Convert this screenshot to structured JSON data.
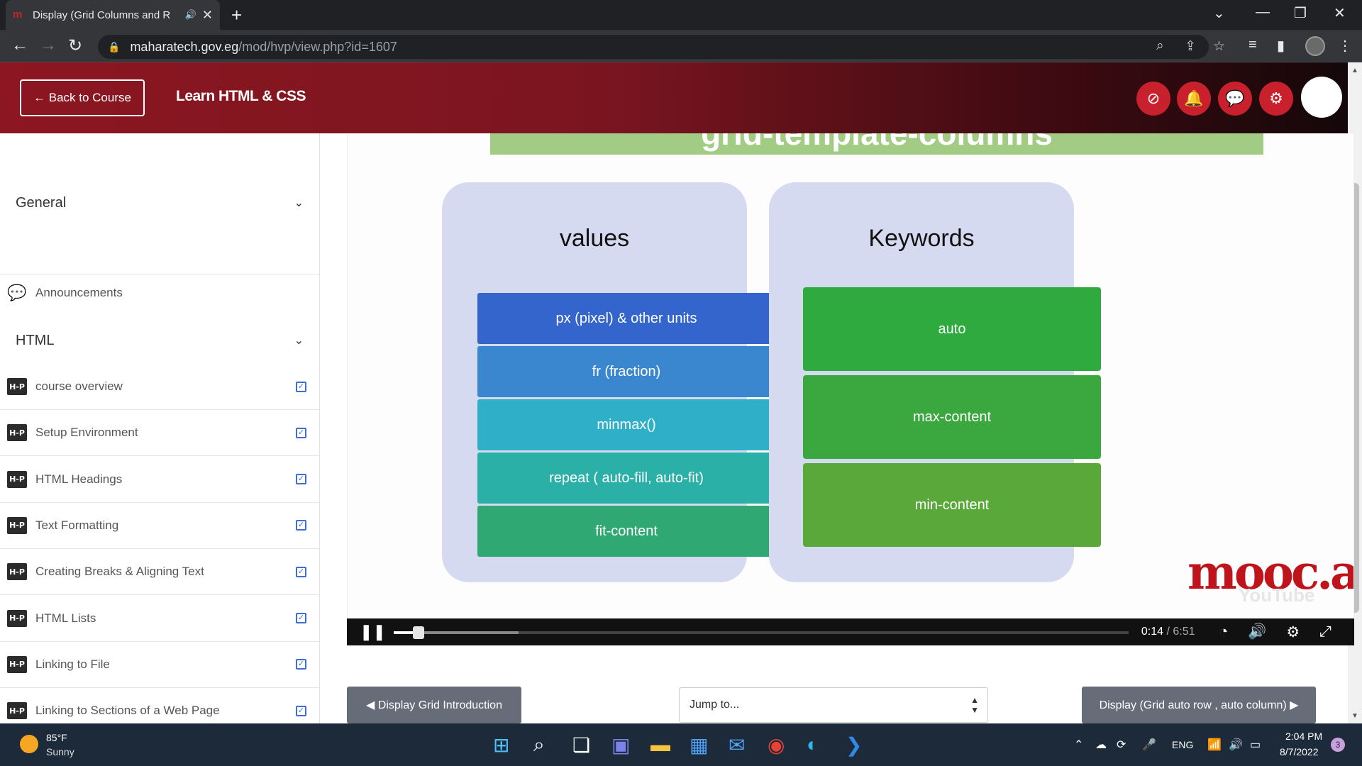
{
  "browser": {
    "tab_title": "Display (Grid Columns and R",
    "url_host": "maharatech.gov.eg",
    "url_path": "/mod/hvp/view.php?id=1607"
  },
  "header": {
    "back_label": "← Back to Course",
    "course_title": "Learn HTML & CSS"
  },
  "sidebar": {
    "sections": [
      {
        "label": "General"
      },
      {
        "label": "HTML"
      }
    ],
    "announcements": "Announcements",
    "items": [
      {
        "label": "course overview"
      },
      {
        "label": "Setup Environment"
      },
      {
        "label": "HTML Headings"
      },
      {
        "label": "Text Formatting"
      },
      {
        "label": "Creating Breaks & Aligning Text"
      },
      {
        "label": "HTML Lists"
      },
      {
        "label": "Linking to File"
      },
      {
        "label": "Linking to Sections of a Web Page"
      }
    ],
    "icon_text": "H-P"
  },
  "video": {
    "slide_title": "grid-template-columns",
    "values_title": "values",
    "keywords_title": "Keywords",
    "values": [
      "px (pixel) & other units",
      "fr (fraction)",
      "minmax()",
      "repeat ( auto-fill, auto-fit)",
      "fit-content"
    ],
    "keywords": [
      "auto",
      "max-content",
      "min-content"
    ],
    "logo_text": "mooc.a",
    "youtube_text": "YouTube",
    "current_time": "0:14",
    "duration": "/ 6:51",
    "progress_fraction": 0.034,
    "buffered_fraction": 0.17
  },
  "nav": {
    "prev_label": "◀ Display Grid Introduction",
    "jump_placeholder": "Jump to...",
    "next_label": "Display (Grid auto row , auto column) ▶"
  },
  "taskbar": {
    "temp": "85°F",
    "condition": "Sunny",
    "lang": "ENG",
    "time": "2:04 PM",
    "date": "8/7/2022",
    "notification_count": "3"
  },
  "colors": {
    "header_red": "#8c1621",
    "header_button": "#c8202c",
    "values_box": [
      "#3465cc",
      "#3a86cf",
      "#2fb0c8",
      "#2bb0a8",
      "#2fa873"
    ],
    "keyword_box": [
      "#2faa3e",
      "#3aa83e",
      "#5aa83a"
    ]
  }
}
